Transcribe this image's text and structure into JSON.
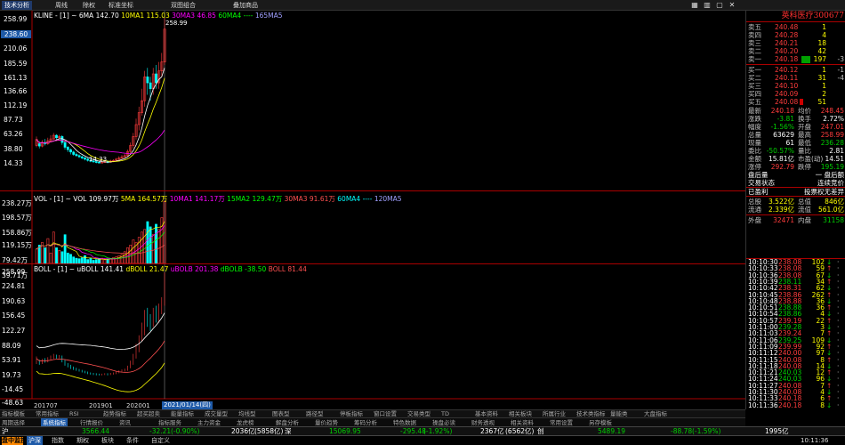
{
  "menu": {
    "logo": "技术分析",
    "items": [
      "周线",
      "除权",
      "标准坐标",
      "双图组合",
      "叠加商品"
    ]
  },
  "stock": {
    "title": "英科医疗300677"
  },
  "price_axis": {
    "current_label": "238.60",
    "ticks": [
      "258.99",
      "238.60",
      "210.06",
      "185.59",
      "161.13",
      "136.66",
      "112.19",
      "87.73",
      "63.26",
      "38.80",
      "14.33"
    ]
  },
  "ma_line": [
    {
      "text": "KLINE - [1] ~ ",
      "color": "#ffffff"
    },
    {
      "text": "6MA 142.70",
      "color": "#ffffff"
    },
    {
      "text": "10MA1 115.03",
      "color": "#ffff00"
    },
    {
      "text": "30MA3 46.85",
      "color": "#ff00ff"
    },
    {
      "text": "60MA4 ----",
      "color": "#00ff00"
    },
    {
      "text": "165MA5",
      "color": "#a0a0ff"
    }
  ],
  "price_annotations": {
    "high": "258.99",
    "low": "14.33"
  },
  "vol": {
    "ticks": [
      "238.27万",
      "198.57万",
      "158.86万",
      "119.15万",
      "79.42万",
      "39.71万"
    ],
    "info": [
      {
        "text": "VOL - [1] ~ VOL 109.97万",
        "color": "#ffffff"
      },
      {
        "text": "5MA 164.57万",
        "color": "#ffff00"
      },
      {
        "text": "10MA1 141.17万",
        "color": "#ff00ff"
      },
      {
        "text": "15MA2 129.47万",
        "color": "#00ff00"
      },
      {
        "text": "30MA3 91.61万",
        "color": "#ff5050"
      },
      {
        "text": "60MA4 ----",
        "color": "#00ffff"
      },
      {
        "text": "120MA5",
        "color": "#a0a0ff"
      }
    ]
  },
  "boll": {
    "ticks": [
      "258.99",
      "224.81",
      "190.63",
      "156.45",
      "122.27",
      "88.09",
      "53.91",
      "19.73",
      "-14.45",
      "-48.63"
    ],
    "info": [
      {
        "text": "BOLL - [1] ~ uBOLL 141.41",
        "color": "#ffffff"
      },
      {
        "text": "dBOLL 21.47",
        "color": "#ffff00"
      },
      {
        "text": "uBOLB 201.38",
        "color": "#ff00ff"
      },
      {
        "text": "dBOLB -38.50",
        "color": "#00ff00"
      },
      {
        "text": "BOLL 81.44",
        "color": "#ff5050"
      }
    ]
  },
  "x_axis": {
    "labels": [
      "201707",
      "201901",
      "202001"
    ],
    "cursor_date": "2021/01/14(四)"
  },
  "orderbook": {
    "asks": [
      {
        "label": "卖五",
        "price": "240.48",
        "vol": "1",
        "chg": ""
      },
      {
        "label": "卖四",
        "price": "240.28",
        "vol": "4",
        "chg": ""
      },
      {
        "label": "卖三",
        "price": "240.21",
        "vol": "18",
        "chg": ""
      },
      {
        "label": "卖二",
        "price": "240.20",
        "vol": "42",
        "chg": ""
      },
      {
        "label": "卖一",
        "price": "240.18",
        "vol": "197",
        "chg": "-3"
      }
    ],
    "bids": [
      {
        "label": "买一",
        "price": "240.12",
        "vol": "1",
        "chg": "-1"
      },
      {
        "label": "买二",
        "price": "240.11",
        "vol": "31",
        "chg": "-4"
      },
      {
        "label": "买三",
        "price": "240.10",
        "vol": "1",
        "chg": ""
      },
      {
        "label": "买四",
        "price": "240.09",
        "vol": "2",
        "chg": ""
      },
      {
        "label": "买五",
        "price": "240.08",
        "vol": "51",
        "chg": ""
      }
    ]
  },
  "quote": [
    {
      "l1": "最新",
      "v1": "240.18",
      "c1": "red",
      "l2": "均价",
      "v2": "248.45",
      "c2": "red"
    },
    {
      "l1": "涨跌",
      "v1": "-3.81",
      "c1": "green",
      "l2": "换手",
      "v2": "2.72%",
      "c2": "white"
    },
    {
      "l1": "幅度",
      "v1": "-1.56%",
      "c1": "green",
      "l2": "开盘",
      "v2": "247.01",
      "c2": "red"
    },
    {
      "l1": "总量",
      "v1": "63629",
      "c1": "white",
      "l2": "最高",
      "v2": "258.99",
      "c2": "red"
    },
    {
      "l1": "现量",
      "v1": "61",
      "c1": "white",
      "l2": "最低",
      "v2": "236.28",
      "c2": "green"
    },
    {
      "l1": "委比",
      "v1": "-50.57%",
      "c1": "green",
      "l2": "量比",
      "v2": "2.81",
      "c2": "white"
    },
    {
      "l1": "金额",
      "v1": "15.81亿",
      "c1": "white",
      "l2": "市盈(动)",
      "v2": "14.51",
      "c2": "white"
    },
    {
      "l1": "涨停",
      "v1": "292.79",
      "c1": "red",
      "l2": "跌停",
      "v2": "195.19",
      "c2": "green"
    }
  ],
  "status_rows": [
    {
      "l": "盘后量",
      "r": "一 盘后额"
    },
    {
      "l": "交易状态",
      "r": "连续竞价"
    },
    {
      "l": "已盈利",
      "r": "投票权无差异"
    }
  ],
  "capital": [
    {
      "l1": "总股",
      "v1": "3.522亿",
      "l2": "总值",
      "v2": "846亿"
    },
    {
      "l1": "流通",
      "v1": "2.339亿",
      "l2": "流值",
      "v2": "561.0亿"
    }
  ],
  "outer_inner": {
    "l1": "外盘",
    "v1": "32471",
    "l2": "内盘",
    "v2": "31158"
  },
  "trades": [
    {
      "t": "10:10:30",
      "p": "238.08",
      "v": "102",
      "c": "red",
      "d": "S"
    },
    {
      "t": "10:10:33",
      "p": "238.08",
      "v": "59",
      "c": "red",
      "d": "B"
    },
    {
      "t": "10:10:36",
      "p": "238.08",
      "v": "67",
      "c": "red",
      "d": "S"
    },
    {
      "t": "10:10:39",
      "p": "238.11",
      "v": "34",
      "c": "green",
      "d": "B"
    },
    {
      "t": "10:10:42",
      "p": "238.31",
      "v": "62",
      "c": "red",
      "d": "S"
    },
    {
      "t": "10:10:45",
      "p": "238.86",
      "v": "262",
      "c": "red",
      "d": "B"
    },
    {
      "t": "10:10:48",
      "p": "238.88",
      "v": "36",
      "c": "red",
      "d": "S"
    },
    {
      "t": "10:10:51",
      "p": "238.88",
      "v": "36",
      "c": "green",
      "d": "B"
    },
    {
      "t": "10:10:54",
      "p": "238.86",
      "v": "4",
      "c": "green",
      "d": "S"
    },
    {
      "t": "10:10:57",
      "p": "239.19",
      "v": "22",
      "c": "red",
      "d": "B"
    },
    {
      "t": "10:11:00",
      "p": "239.28",
      "v": "3",
      "c": "green",
      "d": "S"
    },
    {
      "t": "10:11:03",
      "p": "239.24",
      "v": "7",
      "c": "red",
      "d": "B"
    },
    {
      "t": "10:11:06",
      "p": "239.25",
      "v": "109",
      "c": "green",
      "d": "S"
    },
    {
      "t": "10:11:09",
      "p": "239.99",
      "v": "92",
      "c": "red",
      "d": "B"
    },
    {
      "t": "10:11:12",
      "p": "240.00",
      "v": "97",
      "c": "red",
      "d": "S"
    },
    {
      "t": "10:11:15",
      "p": "240.08",
      "v": "8",
      "c": "red",
      "d": "B"
    },
    {
      "t": "10:11:18",
      "p": "240.08",
      "v": "14",
      "c": "red",
      "d": "S"
    },
    {
      "t": "10:11:21",
      "p": "240.03",
      "v": "12",
      "c": "green",
      "d": "B"
    },
    {
      "t": "10:11:24",
      "p": "240.03",
      "v": "96",
      "c": "green",
      "d": "S"
    },
    {
      "t": "10:11:27",
      "p": "240.08",
      "v": "7",
      "c": "red",
      "d": "B"
    },
    {
      "t": "10:11:30",
      "p": "240.08",
      "v": "4",
      "c": "red",
      "d": "S"
    },
    {
      "t": "10:11:33",
      "p": "240.18",
      "v": "6",
      "c": "red",
      "d": "B"
    },
    {
      "t": "10:11:36",
      "p": "240.18",
      "v": "8",
      "c": "red",
      "d": "S"
    }
  ],
  "bottom_tabs1": [
    "指标模板",
    "常用指标",
    "RSI",
    "趋势指标",
    "超买超卖",
    "能量指标",
    "成交量型",
    "均线型",
    "图表型",
    "路径型",
    "停板指标",
    "窗口设置",
    "交易类型",
    "TD",
    "基本资料",
    "相关板块",
    "所属行业",
    "技术类指标",
    "量能类",
    "大盘指标"
  ],
  "bottom_tabs2": [
    "周期选择",
    "系统指标",
    "行情报价",
    "资讯",
    "指标服务",
    "主力资金",
    "龙虎榜",
    "解盘分析",
    "量价趋势",
    "筹码分析",
    "特色数据",
    "操盘必读",
    "财务透视",
    "相关资料",
    "常用设置",
    "另存模板"
  ],
  "status": {
    "sh": {
      "name": "沪",
      "val": "3566.44",
      "chg": "-32.21",
      "pct": "(-0.90%)",
      "amt": "2036亿",
      "ext": "(5858亿)"
    },
    "sz": {
      "name": "深",
      "val": "15069.95",
      "chg": "-295.48",
      "pct": "(-1.92%)",
      "amt": "2367亿",
      "ext": "(6562亿)"
    },
    "cy": {
      "name": "创",
      "val": "5489.19",
      "chg": "-88.78",
      "pct": "(-1.59%)",
      "amt": "1995亿"
    }
  },
  "ticker": {
    "button": "盘中监控",
    "tabs": [
      "沪深",
      "指数",
      "期权",
      "板块",
      "条件",
      "自定义"
    ],
    "right": "10:11:36"
  }
}
